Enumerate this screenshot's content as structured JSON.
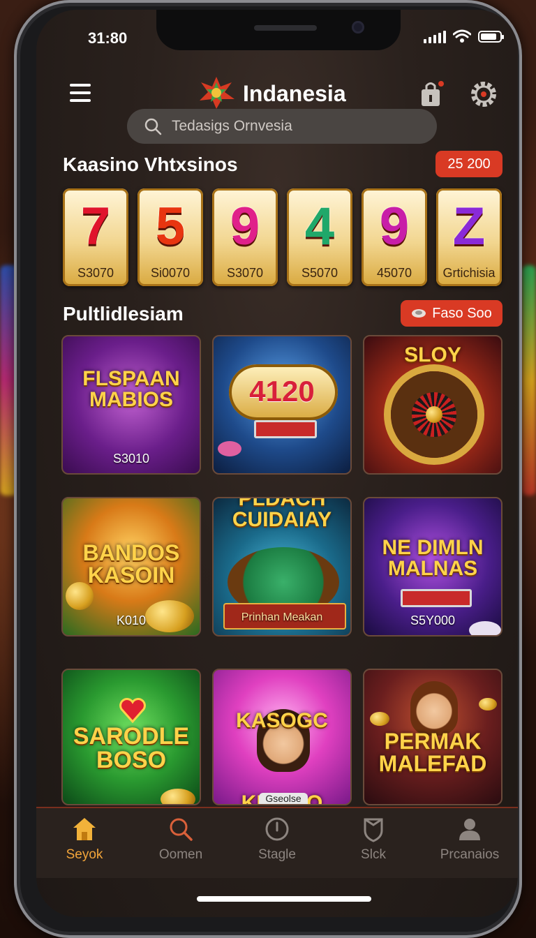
{
  "status": {
    "time": "31:80"
  },
  "header": {
    "title": "Indanesia"
  },
  "search": {
    "placeholder": "Tedasigs Ornvesia"
  },
  "section1": {
    "title": "Kaasino Vhtxsinos",
    "badge": "25 200"
  },
  "reels": [
    {
      "digit": "7",
      "label": "S3070",
      "color": "#e0142c"
    },
    {
      "digit": "5",
      "label": "Si0070",
      "color": "#e83510"
    },
    {
      "digit": "9",
      "label": "S3070",
      "color": "#e0208a"
    },
    {
      "digit": "4",
      "label": "S5070",
      "color": "#20a86a"
    },
    {
      "digit": "9",
      "label": "45070",
      "color": "#c81ea8"
    },
    {
      "digit": "Z",
      "label": "Grtichisia",
      "color": "#8a2ad8"
    }
  ],
  "section2": {
    "title": "Pultlidlesiam",
    "badge": "Faso Soo"
  },
  "tiles": [
    {
      "title": "FLSPAAN MABIOS",
      "foot": "S3010"
    },
    {
      "title": "4120",
      "foot": ""
    },
    {
      "title": "SLOY",
      "foot": ""
    },
    {
      "title": "BANDOS KASOIN",
      "foot": "K010"
    },
    {
      "title": "PLDACH CUIDAIAY",
      "foot": "Prinhan Meakan"
    },
    {
      "title": "NE DIMLN MALNAS",
      "foot": "S5Y000"
    },
    {
      "title": "SARODLE BOSO",
      "foot": ""
    },
    {
      "title": "KASOGC KDSIKO",
      "foot": "Gseolse"
    },
    {
      "title": "PERMAK MALEFAD",
      "foot": ""
    }
  ],
  "tabs": [
    {
      "label": "Seyok",
      "icon": "home-icon"
    },
    {
      "label": "Oomen",
      "icon": "search-icon"
    },
    {
      "label": "Stagle",
      "icon": "clock-icon"
    },
    {
      "label": "Slck",
      "icon": "shield-icon"
    },
    {
      "label": "Prcanaios",
      "icon": "profile-icon"
    }
  ],
  "colors": {
    "accent": "#f2a53a",
    "badge": "#d93a24",
    "background": "#2a211d"
  }
}
